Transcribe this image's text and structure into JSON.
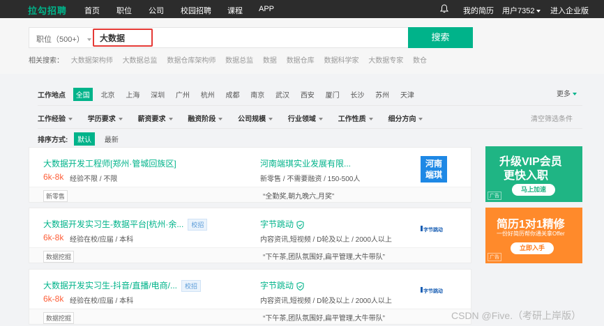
{
  "brand": {
    "logo_text": "拉勾招聘",
    "accent": "#00b38a",
    "salary_color": "#fd5f39"
  },
  "topnav": {
    "items": [
      "首页",
      "职位",
      "公司",
      "校园招聘",
      "课程",
      "APP"
    ],
    "bell_icon": "bell-icon",
    "my_resume": "我的简历",
    "user": "用户7352",
    "enterprise": "进入企业版"
  },
  "search": {
    "category": "职位（500+）",
    "query": "大数据",
    "button": "搜索",
    "related_label": "相关搜索：",
    "related": [
      "大数据架构师",
      "大数据总监",
      "数据仓库架构师",
      "数据总监",
      "数据",
      "数据仓库",
      "数据科学家",
      "大数据专家",
      "数仓"
    ]
  },
  "filters": {
    "location_label": "工作地点",
    "cities": [
      "全国",
      "北京",
      "上海",
      "深圳",
      "广州",
      "杭州",
      "成都",
      "南京",
      "武汉",
      "西安",
      "厦门",
      "长沙",
      "苏州",
      "天津"
    ],
    "more": "更多",
    "dropdowns": [
      "工作经验",
      "学历要求",
      "薪资要求",
      "融资阶段",
      "公司规模",
      "行业领域",
      "工作性质",
      "细分方向"
    ],
    "clear": "清空筛选条件"
  },
  "sort": {
    "label": "排序方式:",
    "options": [
      "默认",
      "最新"
    ]
  },
  "jobs": [
    {
      "title": "大数据开发工程师[郑州·管城回族区]",
      "school_tag": "",
      "salary": "6k-8k",
      "reqs": "经验不限 / 不限",
      "company": "河南端琪实业发展有限...",
      "company_info": "新零售 / 不需要融资 / 150-500人",
      "industry_tag": "新零售",
      "welfare": "“全勤奖,朝九晚六,月奖”",
      "logo_text_1": "河南",
      "logo_text_2": "端琪"
    },
    {
      "title": "大数据开发实习生-数据平台[杭州·余...",
      "school_tag": "校招",
      "salary": "6k-8k",
      "reqs": "经验在校/应届 / 本科",
      "company": "字节跳动",
      "company_info": "内容资讯,短视频 / D轮及以上 / 2000人以上",
      "industry_tag": "数据挖掘",
      "welfare": "“下午茶,团队氛围好,扁平管理,大牛带队”",
      "logo_text_1": "字节跳动",
      "logo_text_2": ""
    },
    {
      "title": "大数据开发实习生-抖音/直播/电商/...",
      "school_tag": "校招",
      "salary": "6k-8k",
      "reqs": "经验在校/应届 / 本科",
      "company": "字节跳动",
      "company_info": "内容资讯,短视频 / D轮及以上 / 2000人以上",
      "industry_tag": "数据挖掘",
      "welfare": "“下午茶,团队氛围好,扁平管理,大牛带队”",
      "logo_text_1": "字节跳动",
      "logo_text_2": ""
    }
  ],
  "ads": {
    "vip": {
      "line1": "升级VIP会员",
      "line2": "更快入职",
      "button": "马上加速",
      "badge": "广告",
      "color": "#1fb584"
    },
    "cv": {
      "line1": "简历1对1精修",
      "line2": "一份好简历帮你通关拿Offer",
      "button": "立即入手",
      "badge": "广告",
      "color": "#ff8a2b"
    }
  },
  "watermark": "CSDN @Five.（考研上岸版）"
}
